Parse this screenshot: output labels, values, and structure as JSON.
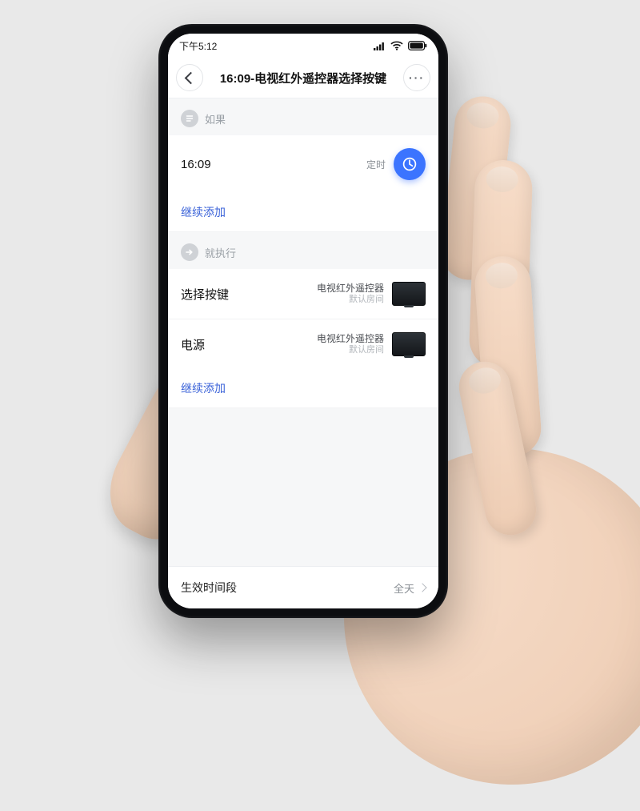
{
  "statusbar": {
    "time": "下午5:12"
  },
  "header": {
    "title": "16:09-电视红外遥控器选择按键"
  },
  "if_section": {
    "label": "如果",
    "trigger_time": "16:09",
    "trigger_type": "定时",
    "add_more": "继续添加"
  },
  "then_section": {
    "label": "就执行",
    "actions": [
      {
        "name": "选择按键",
        "device": "电视红外遥控器",
        "room": "默认房间"
      },
      {
        "name": "电源",
        "device": "电视红外遥控器",
        "room": "默认房间"
      }
    ],
    "add_more": "继续添加"
  },
  "footer": {
    "label": "生效时间段",
    "value": "全天"
  },
  "colors": {
    "accent": "#3b74ff",
    "link": "#3a62d8"
  }
}
